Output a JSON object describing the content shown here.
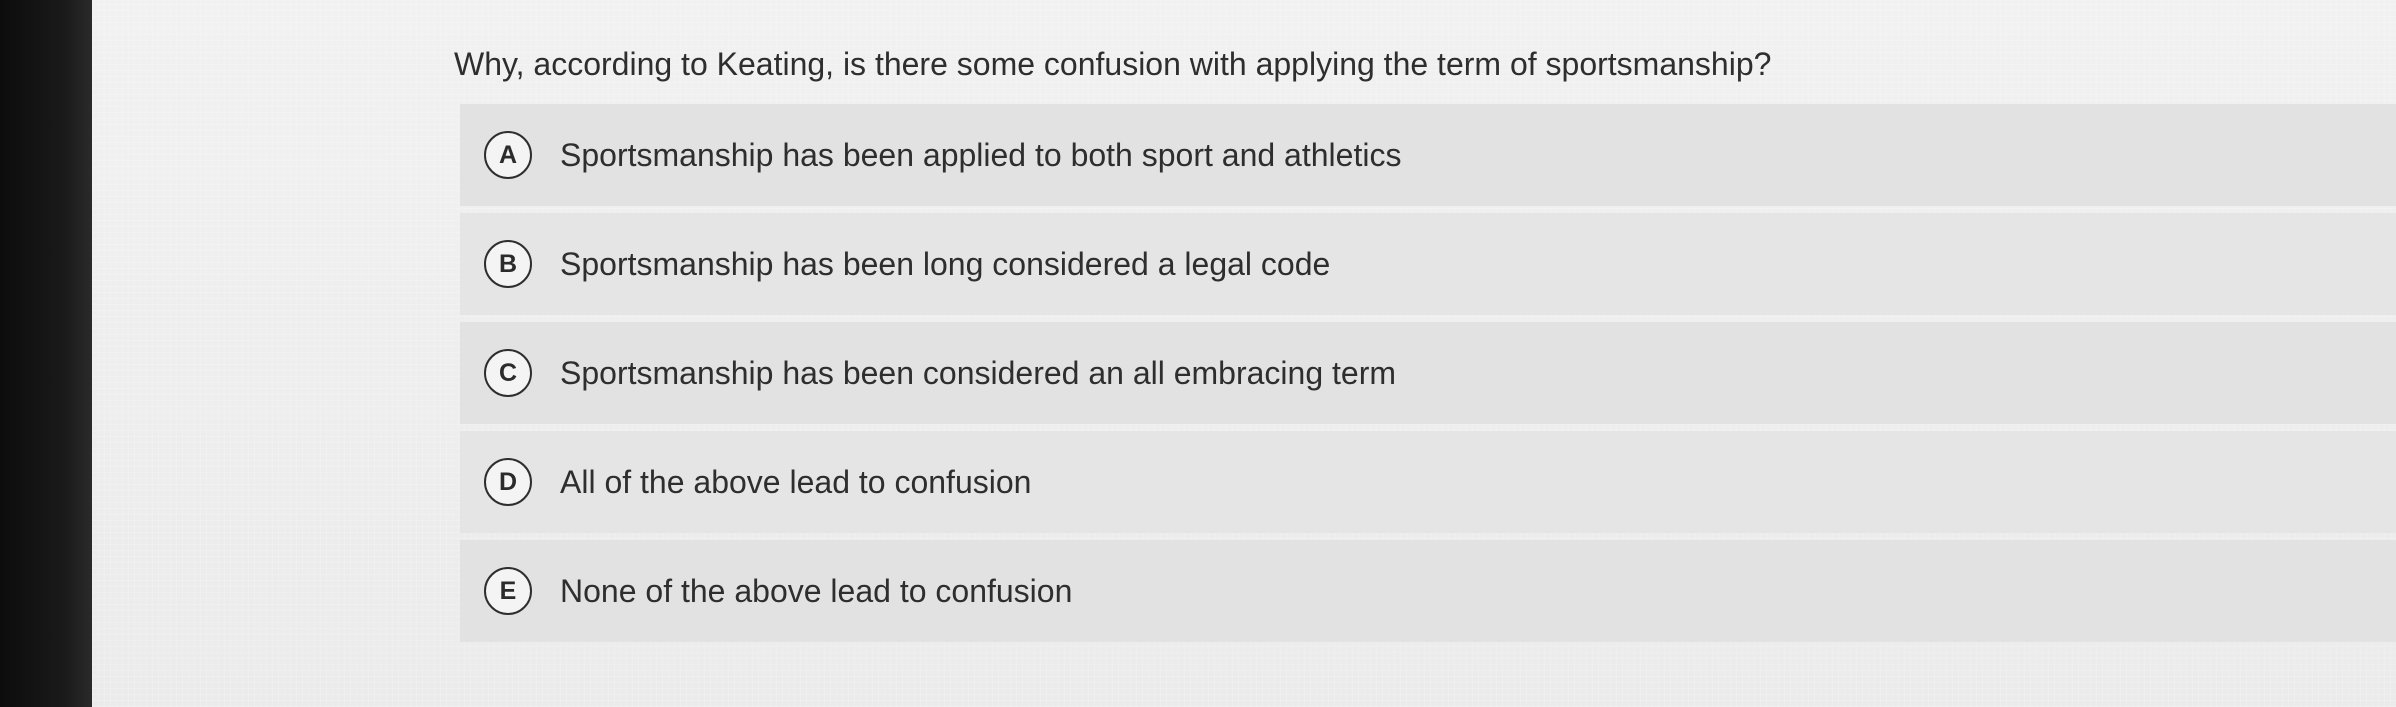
{
  "question": "Why, according to Keating, is there some confusion with applying the term of sportsmanship?",
  "options": [
    {
      "letter": "A",
      "text": "Sportsmanship has been applied to both sport and athletics"
    },
    {
      "letter": "B",
      "text": "Sportsmanship has been long considered a legal code"
    },
    {
      "letter": "C",
      "text": "Sportsmanship has been considered an all embracing term"
    },
    {
      "letter": "D",
      "text": "All of the above lead to confusion"
    },
    {
      "letter": "E",
      "text": "None of the above lead to confusion"
    }
  ]
}
